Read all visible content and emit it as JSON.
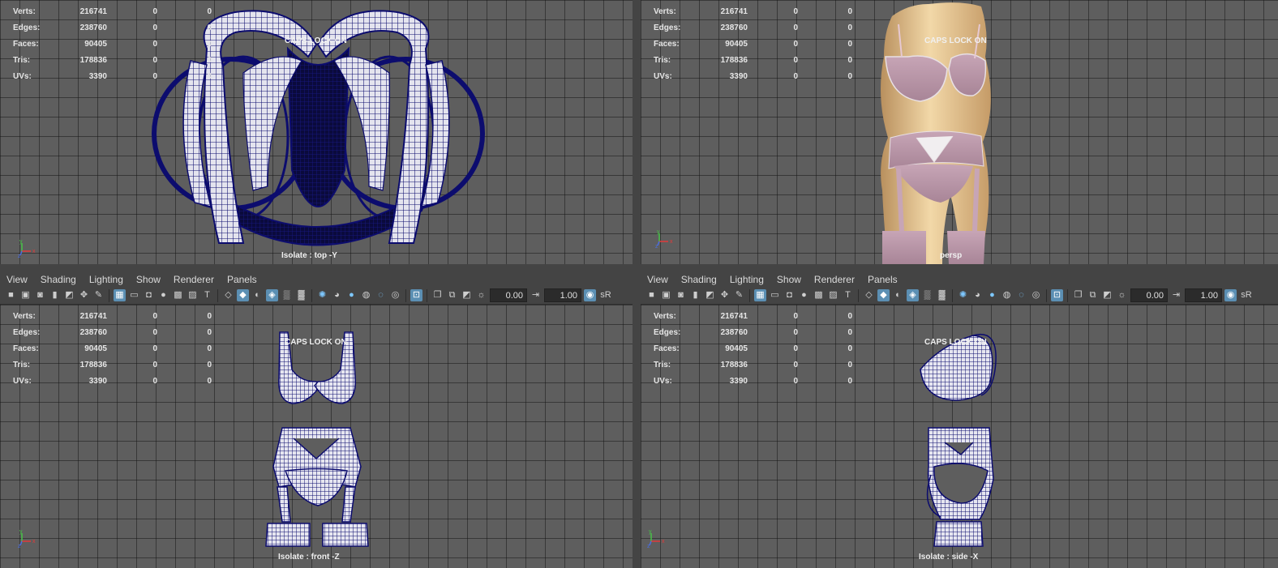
{
  "viewports": [
    {
      "camera_label": "Isolate : top -Y",
      "caps_lock": "CAPS LOCK ON",
      "stats": [
        {
          "label": "Verts:",
          "v1": "216741",
          "v2": "0",
          "v3": "0"
        },
        {
          "label": "Edges:",
          "v1": "238760",
          "v2": "0",
          "v3": "0"
        },
        {
          "label": "Faces:",
          "v1": "90405",
          "v2": "0",
          "v3": "0"
        },
        {
          "label": "Tris:",
          "v1": "178836",
          "v2": "0",
          "v3": "0"
        },
        {
          "label": "UVs:",
          "v1": "3390",
          "v2": "0",
          "v3": "0"
        }
      ],
      "axis": {
        "y": "y",
        "x": "x",
        "z": "z"
      }
    },
    {
      "camera_label": "persp",
      "caps_lock": "CAPS LOCK ON",
      "stats": [
        {
          "label": "Verts:",
          "v1": "216741",
          "v2": "0",
          "v3": "0"
        },
        {
          "label": "Edges:",
          "v1": "238760",
          "v2": "0",
          "v3": "0"
        },
        {
          "label": "Faces:",
          "v1": "90405",
          "v2": "0",
          "v3": "0"
        },
        {
          "label": "Tris:",
          "v1": "178836",
          "v2": "0",
          "v3": "0"
        },
        {
          "label": "UVs:",
          "v1": "3390",
          "v2": "0",
          "v3": "0"
        }
      ],
      "axis": {
        "y": "y",
        "x": "x",
        "z": "z"
      }
    },
    {
      "camera_label": "Isolate : front -Z",
      "caps_lock": "CAPS LOCK ON",
      "stats": [
        {
          "label": "Verts:",
          "v1": "216741",
          "v2": "0",
          "v3": "0"
        },
        {
          "label": "Edges:",
          "v1": "238760",
          "v2": "0",
          "v3": "0"
        },
        {
          "label": "Faces:",
          "v1": "90405",
          "v2": "0",
          "v3": "0"
        },
        {
          "label": "Tris:",
          "v1": "178836",
          "v2": "0",
          "v3": "0"
        },
        {
          "label": "UVs:",
          "v1": "3390",
          "v2": "0",
          "v3": "0"
        }
      ],
      "axis": {
        "y": "y",
        "x": "x",
        "z": "z"
      }
    },
    {
      "camera_label": "Isolate : side -X",
      "caps_lock": "CAPS LOCK ON",
      "stats": [
        {
          "label": "Verts:",
          "v1": "216741",
          "v2": "0",
          "v3": "0"
        },
        {
          "label": "Edges:",
          "v1": "238760",
          "v2": "0",
          "v3": "0"
        },
        {
          "label": "Faces:",
          "v1": "90405",
          "v2": "0",
          "v3": "0"
        },
        {
          "label": "Tris:",
          "v1": "178836",
          "v2": "0",
          "v3": "0"
        },
        {
          "label": "UVs:",
          "v1": "3390",
          "v2": "0",
          "v3": "0"
        }
      ],
      "axis": {
        "y": "y",
        "x": "x",
        "z": "z"
      }
    }
  ],
  "panel_menus": [
    {
      "items": [
        "View",
        "Shading",
        "Lighting",
        "Show",
        "Renderer",
        "Panels"
      ]
    },
    {
      "items": [
        "View",
        "Shading",
        "Lighting",
        "Show",
        "Renderer",
        "Panels"
      ]
    }
  ],
  "toolbars": [
    {
      "near_clip": "0.00",
      "far_clip": "1.00",
      "trailing": "sR"
    },
    {
      "near_clip": "0.00",
      "far_clip": "1.00",
      "trailing": "sR"
    }
  ],
  "toolbar_icons": [
    "camera-icon",
    "camera-attributes-icon",
    "bookmark-camera-icon",
    "bookmark-icon",
    "image-plane-icon",
    "2d-pan-icon",
    "grease-pencil-icon",
    "sep",
    "grid-icon",
    "film-gate-icon",
    "resolution-gate-icon",
    "gate-mask-icon",
    "field-chart-icon",
    "safe-action-icon",
    "safe-title-icon",
    "sep",
    "wireframe-icon",
    "smooth-shade-icon",
    "default-material-icon",
    "wireframe-on-shaded-icon",
    "xray-icon",
    "xray-joints-icon",
    "sep",
    "use-all-lights-icon",
    "shadows-icon",
    "screen-space-ao-icon",
    "motion-blur-icon",
    "multisample-aa-icon",
    "depth-of-field-icon",
    "sep",
    "isolate-select-icon",
    "sep",
    "xray-active-icon",
    "xray-components-icon",
    "toggle-2d-icon",
    "exposure-icon"
  ],
  "colors": {
    "wire": "#0c0c6e",
    "viewport_bg": "#5e5e5e",
    "ui_bg": "#444444",
    "highlight": "#5b8fb3",
    "skin": "#e2c08c",
    "lingerie": "#b894a8",
    "x_axis": "#e23a3a",
    "y_axis": "#46c346",
    "z_axis": "#4a6ee0"
  }
}
